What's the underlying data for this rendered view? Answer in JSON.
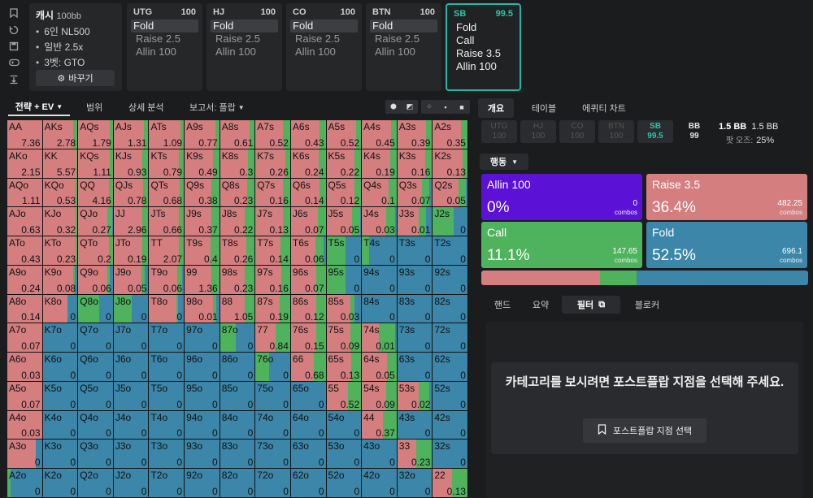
{
  "game": {
    "title": "캐시",
    "stack": "100bb",
    "lines": [
      "6인 NL500",
      "일반 2.5x",
      "3벳: GTO"
    ],
    "change_label": "바꾸기"
  },
  "positions": [
    {
      "name": "UTG",
      "stack": "100",
      "actions": [
        "Fold",
        "Raise 2.5",
        "Allin 100"
      ],
      "selected": 0
    },
    {
      "name": "HJ",
      "stack": "100",
      "actions": [
        "Fold",
        "Raise 2.5",
        "Allin 100"
      ],
      "selected": 0
    },
    {
      "name": "CO",
      "stack": "100",
      "actions": [
        "Fold",
        "Raise 2.5",
        "Allin 100"
      ],
      "selected": 0
    },
    {
      "name": "BTN",
      "stack": "100",
      "actions": [
        "Fold",
        "Raise 2.5",
        "Allin 100"
      ],
      "selected": 0
    },
    {
      "name": "SB",
      "stack": "99.5",
      "actions": [
        "Fold",
        "Call",
        "Raise 3.5",
        "Allin 100"
      ],
      "selected": -1
    }
  ],
  "left_tabs": {
    "strategy": "전략 + EV",
    "range": "범위",
    "detail": "상세 분석",
    "report": "보고서: 플랍"
  },
  "right_tabs": {
    "overview": "개요",
    "table": "테이블",
    "equity": "에퀴티 차트"
  },
  "seats": [
    {
      "name": "UTG",
      "stack": "100"
    },
    {
      "name": "HJ",
      "stack": "100"
    },
    {
      "name": "CO",
      "stack": "100"
    },
    {
      "name": "BTN",
      "stack": "100"
    },
    {
      "name": "SB",
      "stack": "99.5"
    },
    {
      "name": "BB",
      "stack": "99"
    }
  ],
  "pot": {
    "value": "1.5 BB",
    "value2": "1.5 BB",
    "odds_label": "팟 오즈:",
    "odds": "25%"
  },
  "action_dropdown": "행동",
  "actions": [
    {
      "name": "Allin 100",
      "pct": "0%",
      "combos": "0",
      "combos_label": "combos",
      "color": "#5b12d6"
    },
    {
      "name": "Raise 3.5",
      "pct": "36.4%",
      "combos": "482.25",
      "combos_label": "combos",
      "color": "#d47e80"
    },
    {
      "name": "Call",
      "pct": "11.1%",
      "combos": "147.65",
      "combos_label": "combos",
      "color": "#4eb35c"
    },
    {
      "name": "Fold",
      "pct": "52.5%",
      "combos": "696.1",
      "combos_label": "combos",
      "color": "#3b86a9"
    }
  ],
  "freq": {
    "raise": 36.4,
    "call": 11.1,
    "fold": 52.5
  },
  "bottom_tabs": {
    "hand": "핸드",
    "summary": "요약",
    "filter": "필터",
    "blocker": "블로커"
  },
  "filter_message": "카테고리를 보시려면 포스트플랍 지점을 선택해 주세요.",
  "select_button": "포스트플랍 지점 선택",
  "colors": {
    "raise": "#d47e80",
    "call": "#4eb35c",
    "fold": "#3b86a9",
    "allin": "#5b12d6",
    "accent": "#2bb3a2"
  },
  "hands": [
    [
      "AA",
      "7.36",
      1,
      0
    ],
    [
      "AKs",
      "2.78",
      0.88,
      0.12
    ],
    [
      "AQs",
      "1.79",
      0.9,
      0.1
    ],
    [
      "AJs",
      "1.31",
      0.87,
      0.13
    ],
    [
      "ATs",
      "1.09",
      0.9,
      0.1
    ],
    [
      "A9s",
      "0.77",
      0.88,
      0.12
    ],
    [
      "A8s",
      "0.61",
      0.85,
      0.15
    ],
    [
      "A7s",
      "0.52",
      0.8,
      0.2
    ],
    [
      "A6s",
      "0.43",
      0.82,
      0.18
    ],
    [
      "A5s",
      "0.52",
      0.85,
      0.15
    ],
    [
      "A4s",
      "0.45",
      0.85,
      0.15
    ],
    [
      "A3s",
      "0.39",
      0.82,
      0.18
    ],
    [
      "A2s",
      "0.35",
      0.82,
      0.18
    ],
    [
      "AKo",
      "2.15",
      1,
      0
    ],
    [
      "KK",
      "5.57",
      0.96,
      0.04
    ],
    [
      "KQs",
      "1.11",
      0.9,
      0.1
    ],
    [
      "KJs",
      "0.93",
      0.82,
      0.18
    ],
    [
      "KTs",
      "0.79",
      0.85,
      0.15
    ],
    [
      "K9s",
      "0.49",
      0.82,
      0.18
    ],
    [
      "K8s",
      "0.3",
      0.8,
      0.2
    ],
    [
      "K7s",
      "0.26",
      0.85,
      0.15
    ],
    [
      "K6s",
      "0.24",
      0.8,
      0.2
    ],
    [
      "K5s",
      "0.22",
      0.8,
      0.2
    ],
    [
      "K4s",
      "0.19",
      0.82,
      0.18
    ],
    [
      "K3s",
      "0.16",
      0.8,
      0.2
    ],
    [
      "K2s",
      "0.13",
      0.85,
      0.15
    ],
    [
      "AQo",
      "1.11",
      1,
      0
    ],
    [
      "KQo",
      "0.53",
      0.95,
      0.05
    ],
    [
      "QQ",
      "4.16",
      0.88,
      0.12
    ],
    [
      "QJs",
      "0.78",
      0.85,
      0.15
    ],
    [
      "QTs",
      "0.68",
      0.88,
      0.12
    ],
    [
      "Q9s",
      "0.38",
      0.78,
      0.22
    ],
    [
      "Q8s",
      "0.23",
      0.78,
      0.22
    ],
    [
      "Q7s",
      "0.16",
      0.8,
      0.2
    ],
    [
      "Q6s",
      "0.14",
      0.82,
      0.18
    ],
    [
      "Q5s",
      "0.12",
      0.8,
      0.2
    ],
    [
      "Q4s",
      "0.1",
      0.78,
      0.22
    ],
    [
      "Q3s",
      "0.07",
      0.72,
      0.2
    ],
    [
      "Q2s",
      "0.05",
      0.75,
      0.2
    ],
    [
      "AJo",
      "0.63",
      1,
      0
    ],
    [
      "KJo",
      "0.32",
      0.95,
      0.05
    ],
    [
      "QJo",
      "0.27",
      0.85,
      0.12
    ],
    [
      "JJ",
      "2.96",
      0.82,
      0.18
    ],
    [
      "JTs",
      "0.66",
      0.85,
      0.15
    ],
    [
      "J9s",
      "0.37",
      0.78,
      0.22
    ],
    [
      "J8s",
      "0.22",
      0.72,
      0.28
    ],
    [
      "J7s",
      "0.13",
      0.78,
      0.22
    ],
    [
      "J6s",
      "0.07",
      0.78,
      0.22
    ],
    [
      "J5s",
      "0.05",
      0.75,
      0.22
    ],
    [
      "J4s",
      "0.03",
      0.7,
      0.25
    ],
    [
      "J3s",
      "0.01",
      0.62,
      0.2
    ],
    [
      "J2s",
      "0",
      0,
      0.6
    ],
    [
      "ATo",
      "0.43",
      1,
      0
    ],
    [
      "KTo",
      "0.23",
      0.95,
      0.05
    ],
    [
      "QTo",
      "0.2",
      0.88,
      0.12
    ],
    [
      "JTo",
      "0.19",
      0.82,
      0.18
    ],
    [
      "TT",
      "2.07",
      0.85,
      0.15
    ],
    [
      "T9s",
      "0.4",
      0.75,
      0.25
    ],
    [
      "T8s",
      "0.26",
      0.75,
      0.25
    ],
    [
      "T7s",
      "0.14",
      0.72,
      0.28
    ],
    [
      "T6s",
      "0.06",
      0.7,
      0.25
    ],
    [
      "T5s",
      "0",
      0,
      0.55
    ],
    [
      "T4s",
      "0",
      0,
      0.2
    ],
    [
      "T3s",
      "0",
      0,
      0
    ],
    [
      "T2s",
      "0",
      0,
      0
    ],
    [
      "A9o",
      "0.24",
      1,
      0
    ],
    [
      "K9o",
      "0.08",
      0.88,
      0.05
    ],
    [
      "Q9o",
      "0.06",
      0.85,
      0.05
    ],
    [
      "J9o",
      "0.05",
      0.8,
      0.1
    ],
    [
      "T9o",
      "0.06",
      0.8,
      0.15
    ],
    [
      "99",
      "1.36",
      0.78,
      0.22
    ],
    [
      "98s",
      "0.23",
      0.72,
      0.28
    ],
    [
      "97s",
      "0.16",
      0.75,
      0.25
    ],
    [
      "96s",
      "0.07",
      0.72,
      0.28
    ],
    [
      "95s",
      "0",
      0,
      0.55
    ],
    [
      "94s",
      "0",
      0,
      0
    ],
    [
      "93s",
      "0",
      0,
      0
    ],
    [
      "92s",
      "0",
      0,
      0
    ],
    [
      "A8o",
      "0.14",
      1,
      0
    ],
    [
      "K8o",
      "0",
      0.72,
      0
    ],
    [
      "Q8o",
      "0",
      0,
      0.6
    ],
    [
      "J8o",
      "0",
      0,
      0.52
    ],
    [
      "T8o",
      "0",
      0.78,
      0.05
    ],
    [
      "98o",
      "0.01",
      0.82,
      0.1
    ],
    [
      "88",
      "1.05",
      0.72,
      0.28
    ],
    [
      "87s",
      "0.19",
      0.7,
      0.3
    ],
    [
      "86s",
      "0.12",
      0.72,
      0.28
    ],
    [
      "85s",
      "0.03",
      0.68,
      0.12
    ],
    [
      "84s",
      "0",
      0,
      0
    ],
    [
      "83s",
      "0",
      0,
      0
    ],
    [
      "82s",
      "0",
      0,
      0
    ],
    [
      "A7o",
      "0.07",
      1,
      0
    ],
    [
      "K7o",
      "0",
      0,
      0
    ],
    [
      "Q7o",
      "0",
      0,
      0
    ],
    [
      "J7o",
      "0",
      0,
      0
    ],
    [
      "T7o",
      "0",
      0,
      0
    ],
    [
      "97o",
      "0",
      0,
      0
    ],
    [
      "87o",
      "0",
      0,
      0.45
    ],
    [
      "77",
      "0.84",
      0.58,
      0.42
    ],
    [
      "76s",
      "0.15",
      0.72,
      0.28
    ],
    [
      "75s",
      "0.09",
      0.7,
      0.3
    ],
    [
      "74s",
      "0.01",
      0.5,
      0.45
    ],
    [
      "73s",
      "0",
      0,
      0
    ],
    [
      "72s",
      "0",
      0,
      0
    ],
    [
      "A6o",
      "0.03",
      1,
      0
    ],
    [
      "K6o",
      "0",
      0,
      0
    ],
    [
      "Q6o",
      "0",
      0,
      0
    ],
    [
      "J6o",
      "0",
      0,
      0
    ],
    [
      "T6o",
      "0",
      0,
      0
    ],
    [
      "96o",
      "0",
      0,
      0
    ],
    [
      "86o",
      "0",
      0,
      0
    ],
    [
      "76o",
      "0",
      0,
      0.4
    ],
    [
      "66",
      "0.68",
      0.65,
      0.35
    ],
    [
      "65s",
      "0.13",
      0.72,
      0.28
    ],
    [
      "64s",
      "0.05",
      0.72,
      0.28
    ],
    [
      "63s",
      "0",
      0,
      0
    ],
    [
      "62s",
      "0",
      0,
      0
    ],
    [
      "A5o",
      "0.07",
      1,
      0
    ],
    [
      "K5o",
      "0",
      0,
      0
    ],
    [
      "Q5o",
      "0",
      0,
      0
    ],
    [
      "J5o",
      "0",
      0,
      0
    ],
    [
      "T5o",
      "0",
      0,
      0
    ],
    [
      "95o",
      "0",
      0,
      0
    ],
    [
      "85o",
      "0",
      0,
      0
    ],
    [
      "75o",
      "0",
      0,
      0
    ],
    [
      "65o",
      "0",
      0,
      0
    ],
    [
      "55",
      "0.52",
      0.62,
      0.38
    ],
    [
      "54s",
      "0.09",
      0.7,
      0.3
    ],
    [
      "53s",
      "0.02",
      0.62,
      0.3
    ],
    [
      "52s",
      "0",
      0,
      0
    ],
    [
      "A4o",
      "0.03",
      1,
      0
    ],
    [
      "K4o",
      "0",
      0,
      0
    ],
    [
      "Q4o",
      "0",
      0,
      0
    ],
    [
      "J4o",
      "0",
      0,
      0
    ],
    [
      "T4o",
      "0",
      0,
      0
    ],
    [
      "94o",
      "0",
      0,
      0
    ],
    [
      "84o",
      "0",
      0,
      0
    ],
    [
      "74o",
      "0",
      0,
      0
    ],
    [
      "64o",
      "0",
      0,
      0
    ],
    [
      "54o",
      "0",
      0,
      0
    ],
    [
      "44",
      "0.37",
      0.6,
      0.4
    ],
    [
      "43s",
      "0",
      0,
      0
    ],
    [
      "42s",
      "0",
      0,
      0
    ],
    [
      "A3o",
      "0",
      0.82,
      0
    ],
    [
      "K3o",
      "0",
      0,
      0
    ],
    [
      "Q3o",
      "0",
      0,
      0
    ],
    [
      "J3o",
      "0",
      0,
      0
    ],
    [
      "T3o",
      "0",
      0,
      0
    ],
    [
      "93o",
      "0",
      0,
      0
    ],
    [
      "83o",
      "0",
      0,
      0
    ],
    [
      "73o",
      "0",
      0,
      0
    ],
    [
      "63o",
      "0",
      0,
      0
    ],
    [
      "53o",
      "0",
      0,
      0
    ],
    [
      "43o",
      "0",
      0,
      0
    ],
    [
      "33",
      "0.23",
      0.55,
      0.45
    ],
    [
      "32s",
      "0",
      0,
      0
    ],
    [
      "A2o",
      "0",
      0,
      0.1
    ],
    [
      "K2o",
      "0",
      0,
      0
    ],
    [
      "Q2o",
      "0",
      0,
      0
    ],
    [
      "J2o",
      "0",
      0,
      0
    ],
    [
      "T2o",
      "0",
      0,
      0
    ],
    [
      "92o",
      "0",
      0,
      0
    ],
    [
      "82o",
      "0",
      0,
      0
    ],
    [
      "72o",
      "0",
      0,
      0
    ],
    [
      "62o",
      "0",
      0,
      0
    ],
    [
      "52o",
      "0",
      0,
      0
    ],
    [
      "42o",
      "0",
      0,
      0
    ],
    [
      "32o",
      "0",
      0,
      0
    ],
    [
      "22",
      "0.13",
      0.55,
      0.45
    ]
  ]
}
